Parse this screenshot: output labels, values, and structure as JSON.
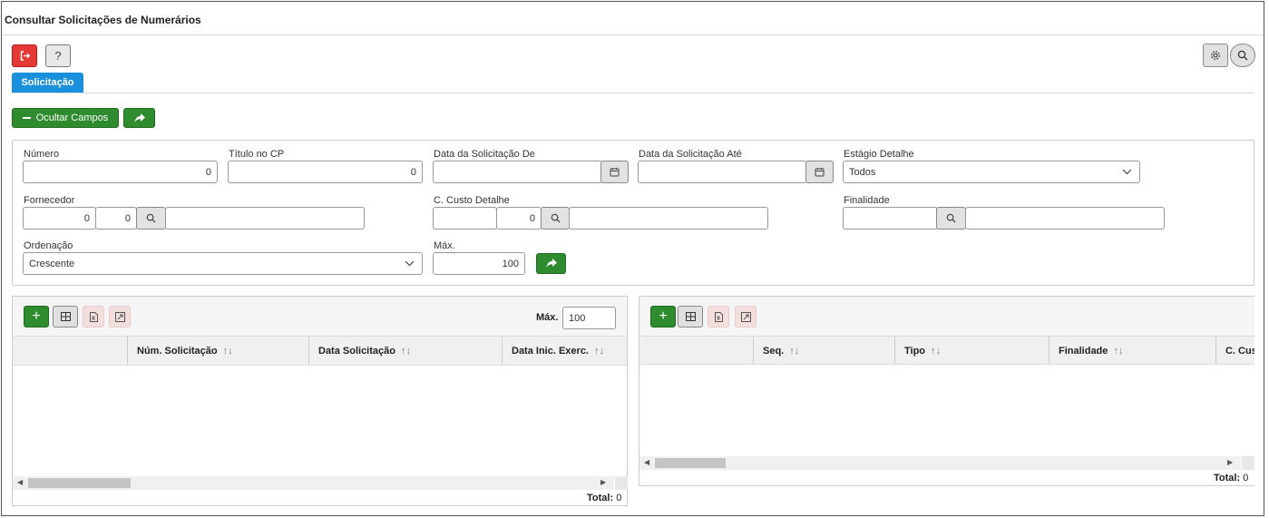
{
  "window": {
    "title": "Consultar Solicitações de Numerários"
  },
  "toolbar": {
    "exit_icon": "exit-icon",
    "help_label": "?",
    "settings_icon": "gear-icon",
    "search_icon": "search-icon"
  },
  "tabs": [
    {
      "label": "Solicitação",
      "active": true
    }
  ],
  "actions": {
    "hide_fields_label": "Ocultar Campos",
    "go_icon": "share-arrow-icon"
  },
  "form": {
    "numero": {
      "label": "Número",
      "value": "0"
    },
    "titulo_cp": {
      "label": "Título no CP",
      "value": "0"
    },
    "data_de": {
      "label": "Data da Solicitação De",
      "value": ""
    },
    "data_ate": {
      "label": "Data da Solicitação Até",
      "value": ""
    },
    "estagio": {
      "label": "Estágio Detalhe",
      "value": "Todos"
    },
    "fornecedor": {
      "label": "Fornecedor",
      "value1": "0",
      "value2": "0",
      "desc": ""
    },
    "custo": {
      "label": "C. Custo Detalhe",
      "value1": "",
      "value2": "0",
      "desc": ""
    },
    "finalidade": {
      "label": "Finalidade",
      "value": "",
      "desc": ""
    },
    "ordenacao": {
      "label": "Ordenação",
      "value": "Crescente"
    },
    "max": {
      "label": "Máx.",
      "value": "100"
    }
  },
  "grid_left": {
    "max_label": "Máx.",
    "max_value": "100",
    "columns": [
      "Núm. Solicitação",
      "Data Solicitação",
      "Data Inic. Exerc."
    ],
    "total_label": "Total:",
    "total_value": "0"
  },
  "grid_right": {
    "columns": [
      "Seq.",
      "Tipo",
      "Finalidade",
      "C. Cus"
    ],
    "total_label": "Total:",
    "total_value": "0"
  },
  "colors": {
    "accent_blue": "#1a8fdb",
    "green": "#2e8b2e",
    "red": "#e53935"
  }
}
